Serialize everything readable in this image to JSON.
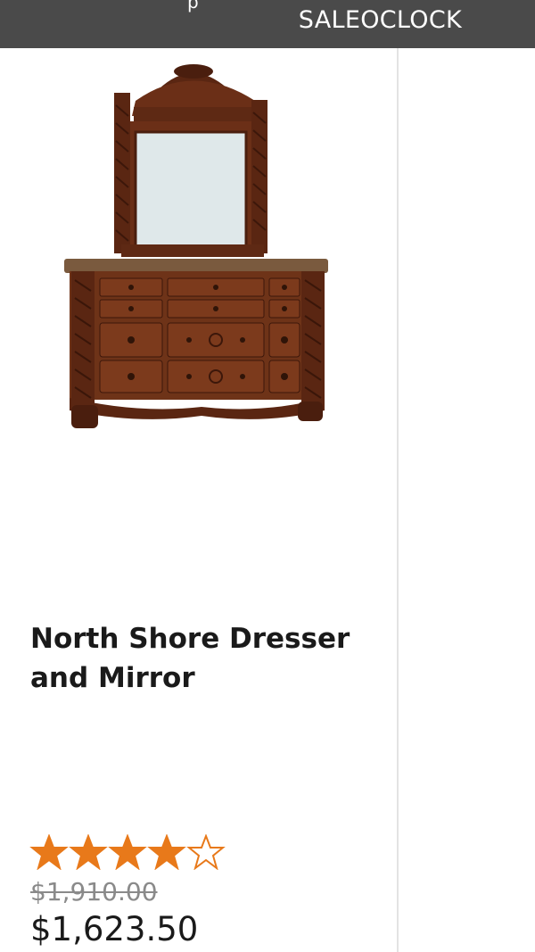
{
  "header": {
    "brand_label": "SALEOCLOCK",
    "partial_text": "p"
  },
  "product": {
    "image_alt": "North Shore Dresser and Mirror",
    "title": "North Shore Dresser and Mirror",
    "rating": 4,
    "rating_max": 5,
    "price_original": "$1,910.00",
    "price_sale": "$1,623.50"
  },
  "colors": {
    "header_bg": "#4a4a4a",
    "star": "#e8791a",
    "wood": "#6b2f17"
  }
}
